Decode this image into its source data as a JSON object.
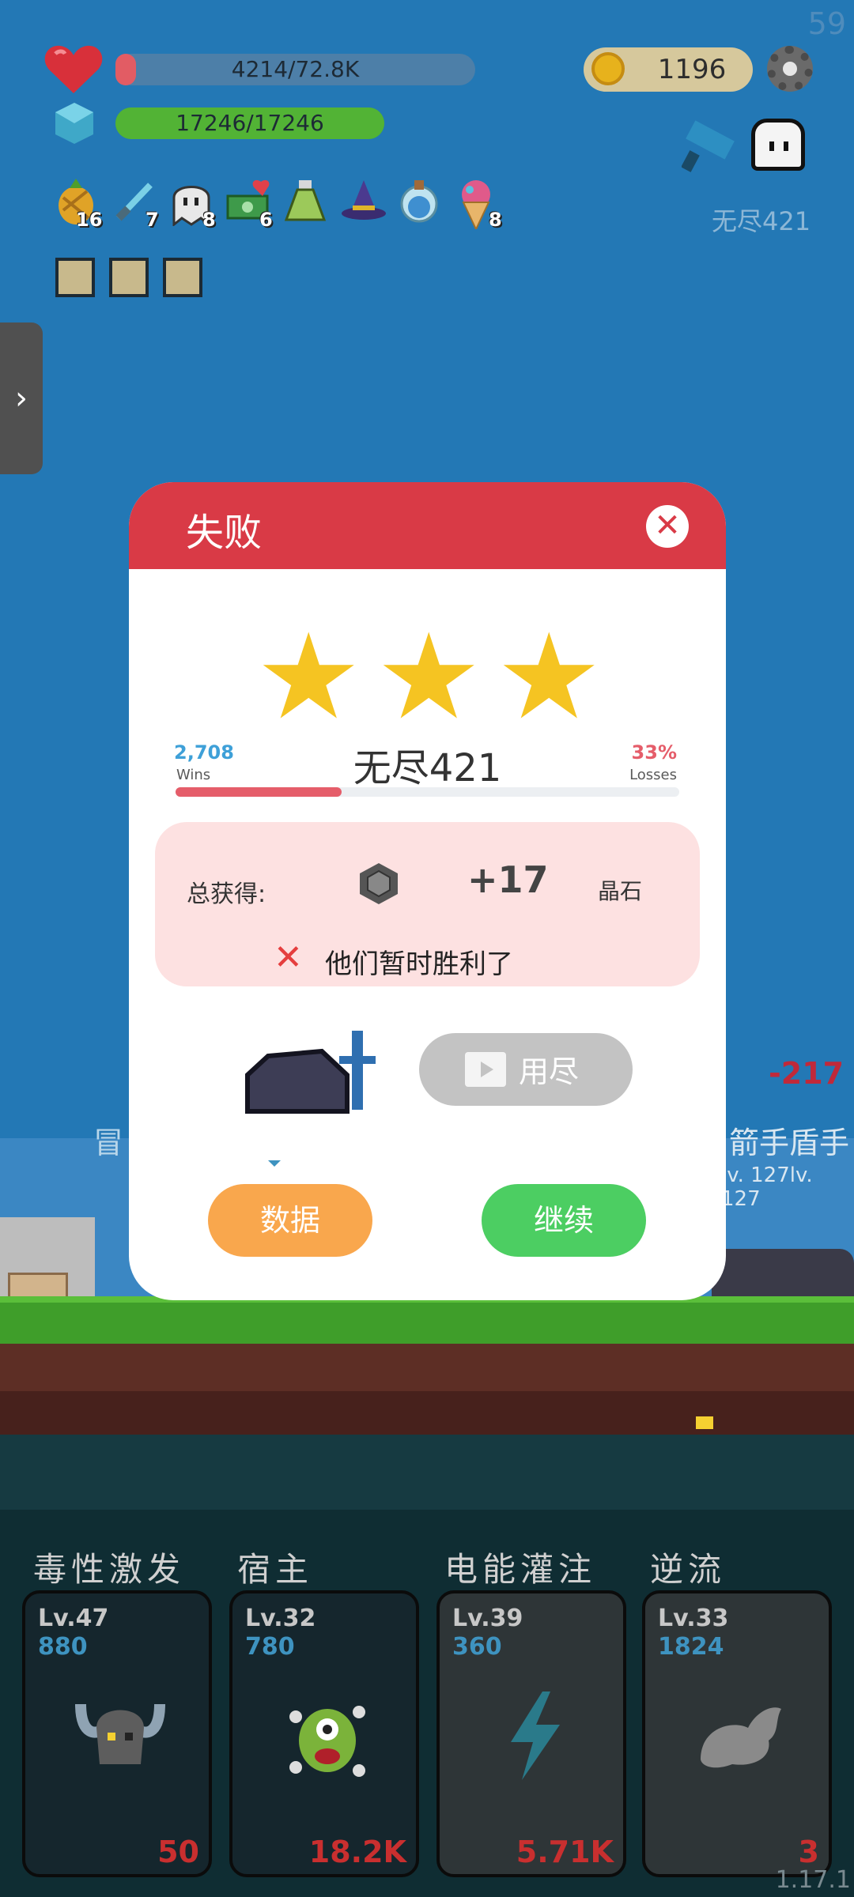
{
  "hud": {
    "fps": "59",
    "hp_text": "4214/72.8K",
    "hp_fraction": 0.058,
    "shield_text": "17246/17246",
    "shield_fraction": 1.0,
    "coins": "1196",
    "stage_label": "无尽421"
  },
  "inventory": [
    {
      "name": "pineapple-icon",
      "count": "16"
    },
    {
      "name": "knife-icon",
      "count": "7"
    },
    {
      "name": "ghost-icon",
      "count": "8"
    },
    {
      "name": "money-heart-icon",
      "count": "6"
    },
    {
      "name": "potion-icon",
      "count": ""
    },
    {
      "name": "wizard-hat-icon",
      "count": ""
    },
    {
      "name": "flask-icon",
      "count": ""
    },
    {
      "name": "ice-cream-icon",
      "count": "8"
    }
  ],
  "dialog": {
    "title": "失败",
    "close": "✕",
    "stars": 3,
    "wins_value": "2,708",
    "wins_label": "Wins",
    "losses_value": "33%",
    "losses_label": "Losses",
    "mode": "无尽421",
    "progress_fraction": 0.33,
    "reward_label": "总获得:",
    "reward_value": "+17",
    "reward_unit": "晶石",
    "result_message": "他们暂时胜利了",
    "ad_button": "用尽",
    "data_button": "数据",
    "continue_button": "继续"
  },
  "skills": [
    {
      "title": "毒性激发",
      "level": "Lv.47",
      "cost": "880",
      "count": "50",
      "icon": "horned-skull-icon"
    },
    {
      "title": "宿主",
      "level": "Lv.32",
      "cost": "780",
      "count": "18.2K",
      "icon": "green-monster-icon"
    },
    {
      "title": "电能灌注",
      "level": "Lv.39",
      "cost": "360",
      "count": "5.71K",
      "icon": "lightning-icon"
    },
    {
      "title": "逆流",
      "level": "Lv.33",
      "cost": "1824",
      "count": "3",
      "icon": "wing-icon"
    }
  ],
  "background_text": {
    "damage": "-217",
    "enemy_names": "箭手盾手",
    "enemy_levels": "lv. 127lv. 127",
    "left_partial": "冒"
  },
  "version": "1.17.1",
  "colors": {
    "danger": "#d93a46",
    "data_button": "#f9a74d",
    "continue_button": "#4cce62"
  }
}
